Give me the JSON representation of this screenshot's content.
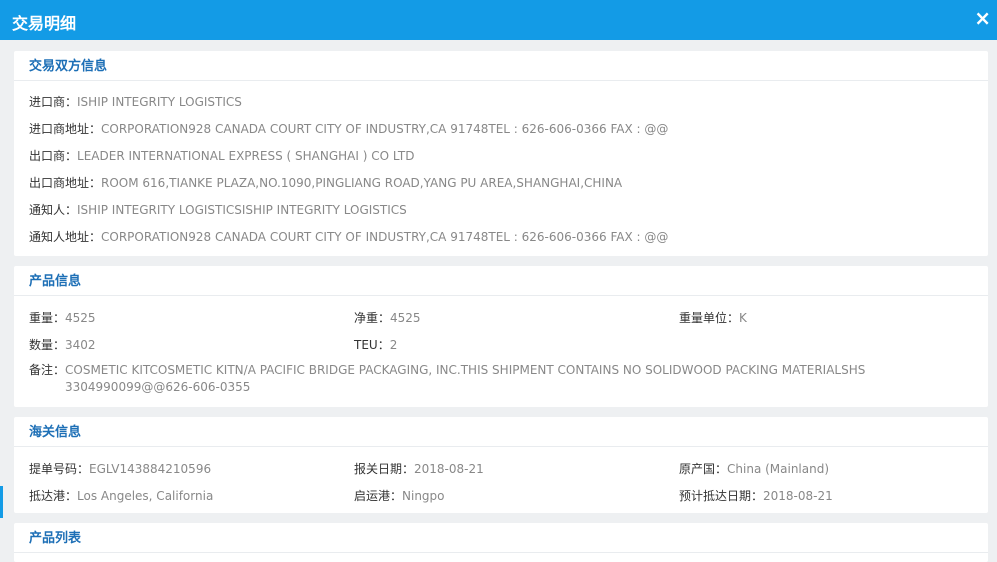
{
  "dialog": {
    "title": "交易明细",
    "close_glyph": "×"
  },
  "parties": {
    "title": "交易双方信息",
    "rows": [
      {
        "label": "进口商：",
        "value": "ISHIP INTEGRITY LOGISTICS"
      },
      {
        "label": "进口商地址：",
        "value": "CORPORATION928 CANADA COURT CITY OF INDUSTRY,CA 91748TEL : 626-606-0366 FAX : @@"
      },
      {
        "label": "出口商：",
        "value": "LEADER INTERNATIONAL EXPRESS ( SHANGHAI ) CO LTD"
      },
      {
        "label": "出口商地址：",
        "value": "ROOM 616,TIANKE PLAZA,NO.1090,PINGLIANG ROAD,YANG PU AREA,SHANGHAI,CHINA"
      },
      {
        "label": "通知人：",
        "value": "ISHIP INTEGRITY LOGISTICSISHIP INTEGRITY LOGISTICS"
      },
      {
        "label": "通知人地址：",
        "value": "CORPORATION928 CANADA COURT CITY OF INDUSTRY,CA 91748TEL : 626-606-0366 FAX : @@"
      }
    ]
  },
  "product": {
    "title": "产品信息",
    "gross_weight": {
      "label": "重量：",
      "value": "4525"
    },
    "net_weight": {
      "label": "净重：",
      "value": "4525"
    },
    "weight_unit": {
      "label": "重量单位：",
      "value": "K"
    },
    "quantity": {
      "label": "数量：",
      "value": "3402"
    },
    "teu": {
      "label": "TEU：",
      "value": "2"
    },
    "remark": {
      "label": "备注：",
      "value": "COSMETIC KITCOSMETIC KITN/A PACIFIC BRIDGE PACKAGING, INC.THIS SHIPMENT CONTAINS NO SOLIDWOOD PACKING MATERIALSHS 3304990099@@626-606-0355"
    }
  },
  "customs": {
    "title": "海关信息",
    "bill_no": {
      "label": "提单号码：",
      "value": "EGLV143884210596"
    },
    "declare_date": {
      "label": "报关日期：",
      "value": "2018-08-21"
    },
    "origin": {
      "label": "原产国：",
      "value": "China (Mainland)"
    },
    "arrival_port": {
      "label": "抵达港：",
      "value": "Los Angeles, California"
    },
    "departure_port": {
      "label": "启运港：",
      "value": "Ningpo"
    },
    "eta": {
      "label": "预计抵达日期：",
      "value": "2018-08-21"
    }
  },
  "product_list": {
    "title": "产品列表"
  },
  "colors": {
    "accent": "#139be6",
    "section_title": "#1d6fb6",
    "value_text": "#888888"
  }
}
